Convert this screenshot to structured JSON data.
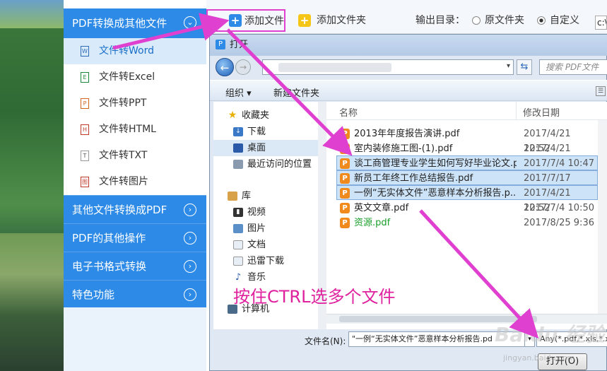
{
  "sidebar": {
    "cat_pdf_to_other": "PDF转换成其他文件",
    "items": [
      {
        "label": "文件转Word",
        "icon": "W"
      },
      {
        "label": "文件转Excel",
        "icon": "E"
      },
      {
        "label": "文件转PPT",
        "icon": "P"
      },
      {
        "label": "文件转HTML",
        "icon": "H"
      },
      {
        "label": "文件转TXT",
        "icon": "T"
      },
      {
        "label": "文件转图片",
        "icon": "图"
      }
    ],
    "cat_other_to_pdf": "其他文件转换成PDF",
    "cat_pdf_ops": "PDF的其他操作",
    "cat_ebook": "电子书格式转换",
    "cat_special": "特色功能"
  },
  "toolbar": {
    "add_file": "添加文件",
    "add_folder": "添加文件夹",
    "output_dir_label": "输出目录：",
    "opt_original": "原文件夹",
    "opt_custom": "自定义",
    "path_value": "c:\\"
  },
  "dialog": {
    "title": "打开",
    "search_placeholder": "搜索 PDF文件",
    "organize": "组织 ▾",
    "new_folder": "新建文件夹",
    "nav": {
      "favorites": "收藏夹",
      "downloads": "下载",
      "desktop": "桌面",
      "recent": "最近访问的位置",
      "library": "库",
      "videos": "视频",
      "pictures": "图片",
      "documents": "文档",
      "thunder": "迅雷下载",
      "music": "音乐",
      "computer": "计算机"
    },
    "columns": {
      "name": "名称",
      "date": "修改日期"
    },
    "files": [
      {
        "name": "2013年年度报告演讲.pdf",
        "date": "2017/4/21 12:52",
        "selected": false
      },
      {
        "name": "室内装修施工图-(1).pdf",
        "date": "2017/4/21 12:52",
        "selected": false
      },
      {
        "name": "谈工商管理专业学生如何写好毕业论文.p...",
        "date": "2017/7/4 10:47",
        "selected": true
      },
      {
        "name": "新员工年终工作总结报告.pdf",
        "date": "2017/7/17 14:12",
        "selected": true
      },
      {
        "name": "一例“无实体文件”恶意样本分析报告.p...",
        "date": "2017/4/21 12:52",
        "selected": true
      },
      {
        "name": "英文文章.pdf",
        "date": "2017/7/4 10:50",
        "selected": false
      },
      {
        "name": "资源.pdf",
        "date": "2017/8/25 9:36",
        "selected": false
      }
    ],
    "filename_label": "文件名(N):",
    "filename_value": "\"一例“无实体文件”恶意样本分析报告.pd",
    "filetype_value": "Any(*.pdf,*.xls,*.x",
    "open_button": "打开(O)"
  },
  "annotation": "按住CTRL选多个文件",
  "watermark": "Baidu 经验",
  "watermark_url": "jingyan.baidu.com",
  "colors": {
    "accent": "#2d8ae6",
    "highlight": "#e040d0"
  }
}
